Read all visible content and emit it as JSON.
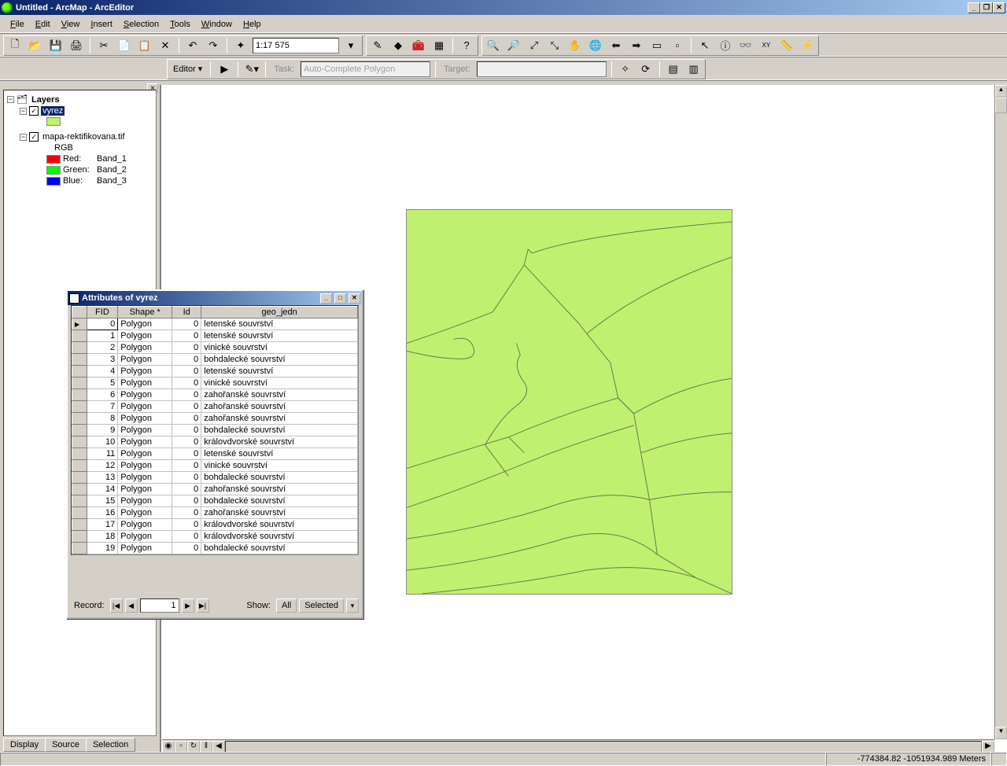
{
  "window": {
    "title": "Untitled - ArcMap - ArcEditor"
  },
  "menu": [
    "File",
    "Edit",
    "View",
    "Insert",
    "Selection",
    "Tools",
    "Window",
    "Help"
  ],
  "scale": "1:17 575",
  "editor": {
    "label": "Editor",
    "task_label": "Task:",
    "task_value": "Auto-Complete Polygon",
    "target_label": "Target:",
    "target_value": ""
  },
  "toc": {
    "root": "Layers",
    "layer1": {
      "name": "vyrez",
      "checked": true,
      "expanded": true,
      "swatch": "#c0f070"
    },
    "layer2": {
      "name": "mapa-rektifikovana.tif",
      "checked": true,
      "expanded": true,
      "type": "RGB",
      "bands": [
        {
          "color": "#ff0000",
          "label": "Red:",
          "value": "Band_1"
        },
        {
          "color": "#00ff00",
          "label": "Green:",
          "value": "Band_2"
        },
        {
          "color": "#0000ff",
          "label": "Blue:",
          "value": "Band_3"
        }
      ]
    },
    "tabs": [
      "Display",
      "Source",
      "Selection"
    ]
  },
  "attr": {
    "title": "Attributes of vyrez",
    "columns": [
      "FID",
      "Shape *",
      "Id",
      "geo_jedn"
    ],
    "rows": [
      {
        "fid": 0,
        "shape": "Polygon",
        "id": 0,
        "geo": "letenské souvrství"
      },
      {
        "fid": 1,
        "shape": "Polygon",
        "id": 0,
        "geo": "letenské souvrství"
      },
      {
        "fid": 2,
        "shape": "Polygon",
        "id": 0,
        "geo": "vinické souvrství"
      },
      {
        "fid": 3,
        "shape": "Polygon",
        "id": 0,
        "geo": "bohdalecké souvrství"
      },
      {
        "fid": 4,
        "shape": "Polygon",
        "id": 0,
        "geo": "letenské souvrství"
      },
      {
        "fid": 5,
        "shape": "Polygon",
        "id": 0,
        "geo": "vinické souvrství"
      },
      {
        "fid": 6,
        "shape": "Polygon",
        "id": 0,
        "geo": "zahořanské souvrství"
      },
      {
        "fid": 7,
        "shape": "Polygon",
        "id": 0,
        "geo": "zahořanské souvrství"
      },
      {
        "fid": 8,
        "shape": "Polygon",
        "id": 0,
        "geo": "zahořanské souvrství"
      },
      {
        "fid": 9,
        "shape": "Polygon",
        "id": 0,
        "geo": "bohdalecké souvrství"
      },
      {
        "fid": 10,
        "shape": "Polygon",
        "id": 0,
        "geo": "královdvorské souvrství"
      },
      {
        "fid": 11,
        "shape": "Polygon",
        "id": 0,
        "geo": "letenské souvrství"
      },
      {
        "fid": 12,
        "shape": "Polygon",
        "id": 0,
        "geo": "vinické souvrství"
      },
      {
        "fid": 13,
        "shape": "Polygon",
        "id": 0,
        "geo": "bohdalecké souvrství"
      },
      {
        "fid": 14,
        "shape": "Polygon",
        "id": 0,
        "geo": "zahořanské souvrství"
      },
      {
        "fid": 15,
        "shape": "Polygon",
        "id": 0,
        "geo": "bohdalecké souvrství"
      },
      {
        "fid": 16,
        "shape": "Polygon",
        "id": 0,
        "geo": "zahořanské souvrství"
      },
      {
        "fid": 17,
        "shape": "Polygon",
        "id": 0,
        "geo": "královdvorské souvrství"
      },
      {
        "fid": 18,
        "shape": "Polygon",
        "id": 0,
        "geo": "královdvorské souvrství"
      },
      {
        "fid": 19,
        "shape": "Polygon",
        "id": 0,
        "geo": "bohdalecké souvrství"
      }
    ],
    "record_label": "Record:",
    "record_value": "1",
    "show_label": "Show:",
    "all_btn": "All",
    "selected_btn": "Selected"
  },
  "status": {
    "coords": "-774384.82 -1051934.989 Meters"
  }
}
